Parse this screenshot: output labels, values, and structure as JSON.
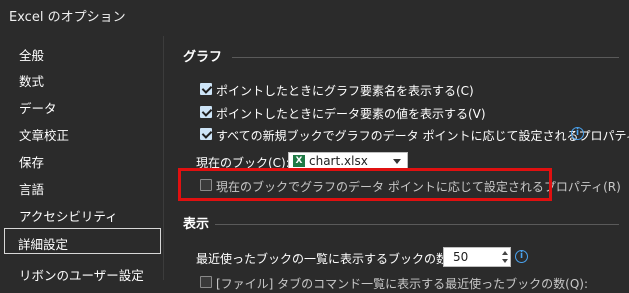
{
  "window": {
    "title": "Excel のオプション"
  },
  "sidebar": {
    "items": [
      {
        "label": "全般"
      },
      {
        "label": "数式"
      },
      {
        "label": "データ"
      },
      {
        "label": "文章校正"
      },
      {
        "label": "保存"
      },
      {
        "label": "言語"
      },
      {
        "label": "アクセシビリティ"
      },
      {
        "label": "詳細設定",
        "selected": true
      },
      {
        "label": "リボンのユーザー設定"
      }
    ]
  },
  "graph_section": {
    "title": "グラフ",
    "options": [
      {
        "label": "ポイントしたときにグラフ要素名を表示する(C)",
        "checked": true
      },
      {
        "label": "ポイントしたときにデータ要素の値を表示する(V)",
        "checked": true
      },
      {
        "label": "すべての新規ブックでグラフのデータ ポイントに応じて設定されるプロパティ(P)",
        "checked": true,
        "info_icon": "info-icon"
      }
    ],
    "current_book_label": "現在のブック(C):",
    "current_book_value": "chart.xlsx",
    "current_book_icon": "excel-file-icon",
    "highlighted_option": {
      "label": "現在のブックでグラフのデータ ポイントに応じて設定されるプロパティ(R)",
      "checked": false
    }
  },
  "display_section": {
    "title": "表示",
    "recent_books_label": "最近使ったブックの一覧に表示するブックの数(R):",
    "recent_books_value": "50",
    "partial_option_label": "[ファイル] タブのコマンド一覧に表示する最近使ったブックの数(Q):"
  },
  "colors": {
    "background": "#2b2b2b",
    "highlight": "#e01010",
    "accent": "#4aa3f0"
  }
}
